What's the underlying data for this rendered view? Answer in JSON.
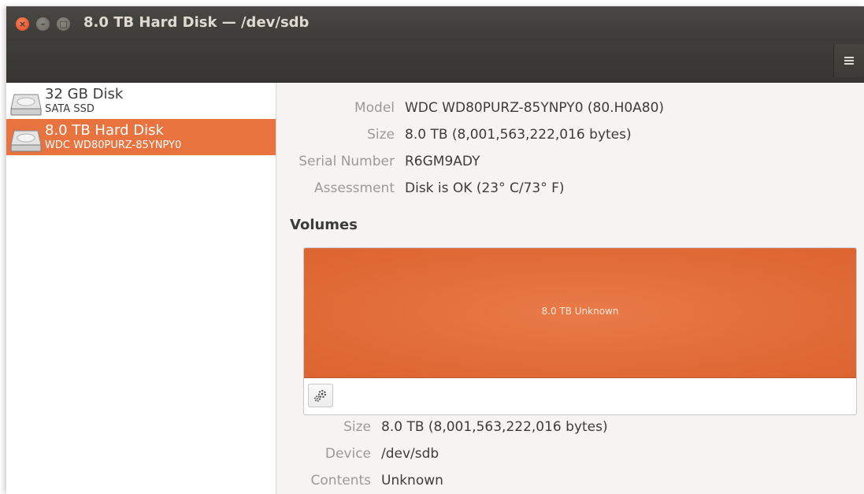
{
  "window": {
    "title": "8.0 TB Hard Disk — /dev/sdb",
    "controls": [
      "close-icon",
      "minimize-icon",
      "maximize-icon"
    ],
    "menu_icon": "hamburger-menu-icon"
  },
  "sidebar": {
    "items": [
      {
        "name": "32 GB Disk",
        "subtitle": "SATA SSD",
        "icon": "hard-disk-icon",
        "selected": false
      },
      {
        "name": "8.0 TB Hard Disk",
        "subtitle": "WDC WD80PURZ-85YNPY0",
        "icon": "hard-disk-icon",
        "selected": true
      }
    ]
  },
  "drive": {
    "model_label": "Model",
    "model_value": "WDC WD80PURZ-85YNPY0 (80.H0A80)",
    "size_label": "Size",
    "size_value": "8.0 TB (8,001,563,222,016 bytes)",
    "serial_label": "Serial Number",
    "serial_value": "R6GM9ADY",
    "assessment_label": "Assessment",
    "assessment_value": "Disk is OK (23° C/73° F)"
  },
  "volumes": {
    "heading": "Volumes",
    "partition_label": "8.0 TB Unknown",
    "gear_icon": "gears-icon",
    "size_label": "Size",
    "size_value": "8.0 TB (8,001,563,222,016 bytes)",
    "device_label": "Device",
    "device_value": "/dev/sdb",
    "contents_label": "Contents",
    "contents_value": "Unknown"
  },
  "colors": {
    "accent": "#e9733f",
    "titlebar": "#3c3b37",
    "close_button": "#e95420"
  }
}
